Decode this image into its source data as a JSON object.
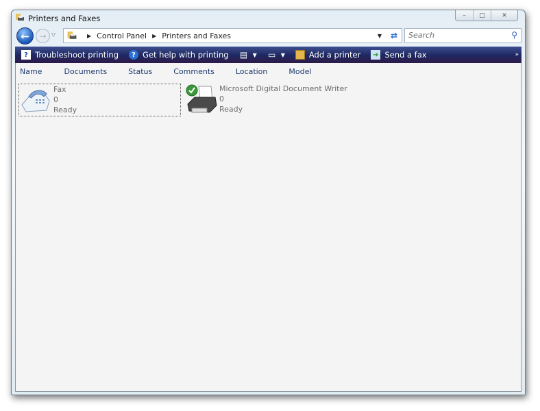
{
  "window": {
    "title": "Printers and Faxes",
    "minimize": "–",
    "maximize": "□",
    "close": "✕"
  },
  "nav": {
    "back_icon": "back-arrow",
    "forward_icon": "forward-arrow"
  },
  "address": {
    "crumbs": [
      "Control Panel",
      "Printers and Faxes"
    ]
  },
  "search": {
    "placeholder": "Search"
  },
  "toolbar": {
    "troubleshoot": "Troubleshoot printing",
    "help": "Get help with printing",
    "add_printer": "Add a printer",
    "send_fax": "Send a fax",
    "more": "»"
  },
  "columns": [
    "Name",
    "Documents",
    "Status",
    "Comments",
    "Location",
    "Model"
  ],
  "items": [
    {
      "name": "Fax",
      "documents": "0",
      "status": "Ready"
    },
    {
      "name": "Microsoft Digital Document Writer",
      "documents": "0",
      "status": "Ready",
      "default": true
    }
  ]
}
